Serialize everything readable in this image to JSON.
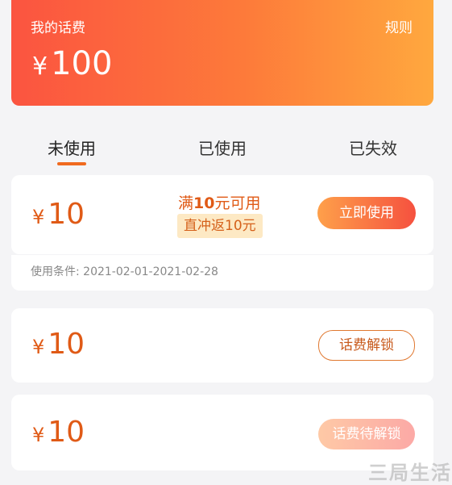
{
  "header": {
    "title": "我的话费",
    "rules_label": "规则",
    "currency": "¥",
    "balance": "100"
  },
  "tabs": [
    {
      "label": "未使用",
      "active": true
    },
    {
      "label": "已使用",
      "active": false
    },
    {
      "label": "已失效",
      "active": false
    }
  ],
  "coupons": [
    {
      "currency": "¥",
      "amount": "10",
      "threshold_prefix": "满",
      "threshold_num": "10",
      "threshold_suffix": "元可用",
      "cashback": "直冲返10元",
      "button": "立即使用",
      "conditions": "使用条件: 2021-02-01-2021-02-28"
    },
    {
      "currency": "¥",
      "amount": "10",
      "button": "话费解锁"
    },
    {
      "currency": "¥",
      "amount": "10",
      "button": "话费待解锁"
    }
  ],
  "watermark": "三局生活",
  "colors": {
    "accent": "#f06a1f",
    "header_start": "#fb5440",
    "header_end": "#ffa83e"
  }
}
